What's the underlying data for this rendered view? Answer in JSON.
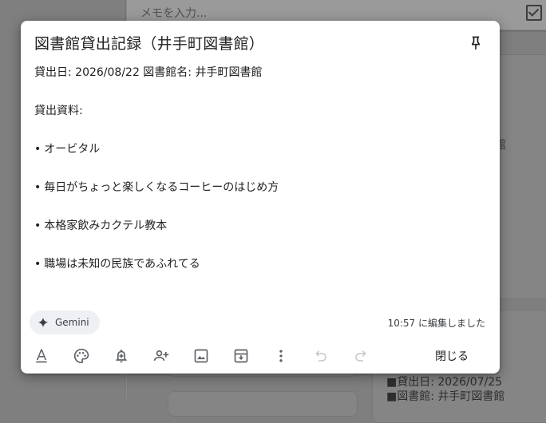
{
  "background": {
    "new_note_placeholder": "メモを入力...",
    "fragments": {
      "paren_top": ")",
      "kan": "館",
      "paren_bottom": ")",
      "line1": "■貸出日: 2026/07/25",
      "line2": "■図書館: 井手町図書館"
    }
  },
  "note": {
    "title": "図書館貸出記録（井手町図書館）",
    "lines": [
      "貸出日: 2026/08/22 図書館名: 井手町図書館",
      "貸出資料:",
      "オービタル",
      "毎日がちょっと楽しくなるコーヒーのはじめ方",
      "本格家飲みカクテル教本",
      "職場は未知の民族であふれてる"
    ],
    "bullet": "•",
    "gemini_label": "Gemini",
    "edited_text": "10:57 に編集しました",
    "close_label": "閉じる"
  },
  "toolbar_icons": [
    "text-format-icon",
    "palette-icon",
    "reminder-icon",
    "collaborator-icon",
    "image-icon",
    "archive-icon",
    "more-icon",
    "undo-icon",
    "redo-icon"
  ],
  "colors": {
    "text": "#202124",
    "icon": "#5f6368",
    "icon_disabled": "#c4c7c5",
    "chip_bg": "#eef0f3",
    "scrim": "#7f7f7f"
  }
}
